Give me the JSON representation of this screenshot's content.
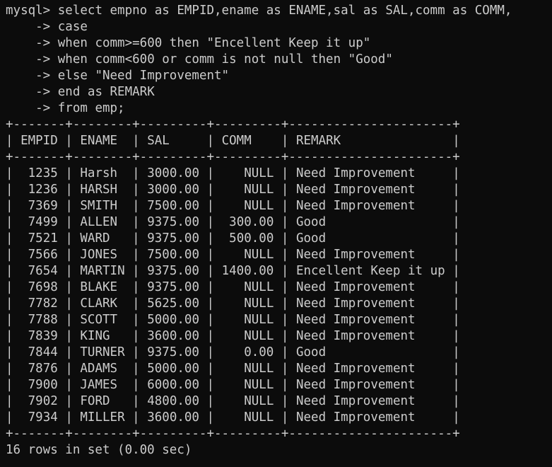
{
  "terminal": {
    "prompt": "mysql> ",
    "continuation": "    -> ",
    "query_lines": [
      "select empno as EMPID,ename as ENAME,sal as SAL,comm as COMM,",
      "case",
      "when comm>=600 then \"Encellent Keep it up\"",
      "when comm<600 or comm is not null then \"Good\"",
      "else \"Need Improvement\"",
      "end as REMARK",
      "from emp;"
    ],
    "table": {
      "columns": [
        "EMPID",
        "ENAME",
        "SAL",
        "COMM",
        "REMARK"
      ],
      "rows": [
        [
          "1235",
          "Harsh",
          "3000.00",
          "NULL",
          "Need Improvement"
        ],
        [
          "1236",
          "HARSH",
          "3000.00",
          "NULL",
          "Need Improvement"
        ],
        [
          "7369",
          "SMITH",
          "7500.00",
          "NULL",
          "Need Improvement"
        ],
        [
          "7499",
          "ALLEN",
          "9375.00",
          "300.00",
          "Good"
        ],
        [
          "7521",
          "WARD",
          "9375.00",
          "500.00",
          "Good"
        ],
        [
          "7566",
          "JONES",
          "7500.00",
          "NULL",
          "Need Improvement"
        ],
        [
          "7654",
          "MARTIN",
          "9375.00",
          "1400.00",
          "Encellent Keep it up"
        ],
        [
          "7698",
          "BLAKE",
          "9375.00",
          "NULL",
          "Need Improvement"
        ],
        [
          "7782",
          "CLARK",
          "5625.00",
          "NULL",
          "Need Improvement"
        ],
        [
          "7788",
          "SCOTT",
          "5000.00",
          "NULL",
          "Need Improvement"
        ],
        [
          "7839",
          "KING",
          "3600.00",
          "NULL",
          "Need Improvement"
        ],
        [
          "7844",
          "TURNER",
          "9375.00",
          "0.00",
          "Good"
        ],
        [
          "7876",
          "ADAMS",
          "5000.00",
          "NULL",
          "Need Improvement"
        ],
        [
          "7900",
          "JAMES",
          "6000.00",
          "NULL",
          "Need Improvement"
        ],
        [
          "7902",
          "FORD",
          "4800.00",
          "NULL",
          "Need Improvement"
        ],
        [
          "7934",
          "MILLER",
          "3600.00",
          "NULL",
          "Need Improvement"
        ]
      ]
    },
    "status": "16 rows in set (0.00 sec)"
  },
  "colors": {
    "background": "#0c0c0c",
    "foreground": "#cccccc"
  }
}
